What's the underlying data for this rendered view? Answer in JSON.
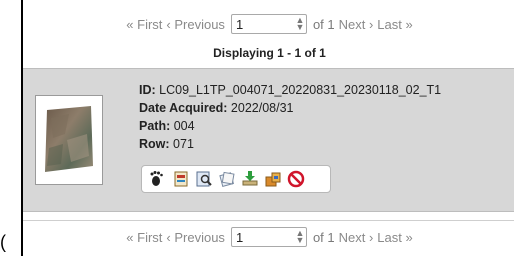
{
  "pager": {
    "first": "« First",
    "previous": "‹ Previous",
    "page_value": "1",
    "of_text": "of 1",
    "next": "Next ›",
    "last": "Last »"
  },
  "displaying": "Displaying 1 - 1 of 1",
  "result": {
    "id_label": "ID:",
    "id_value": " LC09_L1TP_004071_20220831_20230118_02_T1",
    "date_label": "Date Acquired:",
    "date_value": " 2022/08/31",
    "path_label": "Path:",
    "path_value": " 004",
    "row_label": "Row:",
    "row_value": " 071"
  },
  "tool_icons": [
    "footprint-icon",
    "metadata-icon",
    "browse-overlay-icon",
    "compare-icon",
    "download-icon",
    "bulk-download-icon",
    "exclude-icon"
  ],
  "stray_char": "("
}
